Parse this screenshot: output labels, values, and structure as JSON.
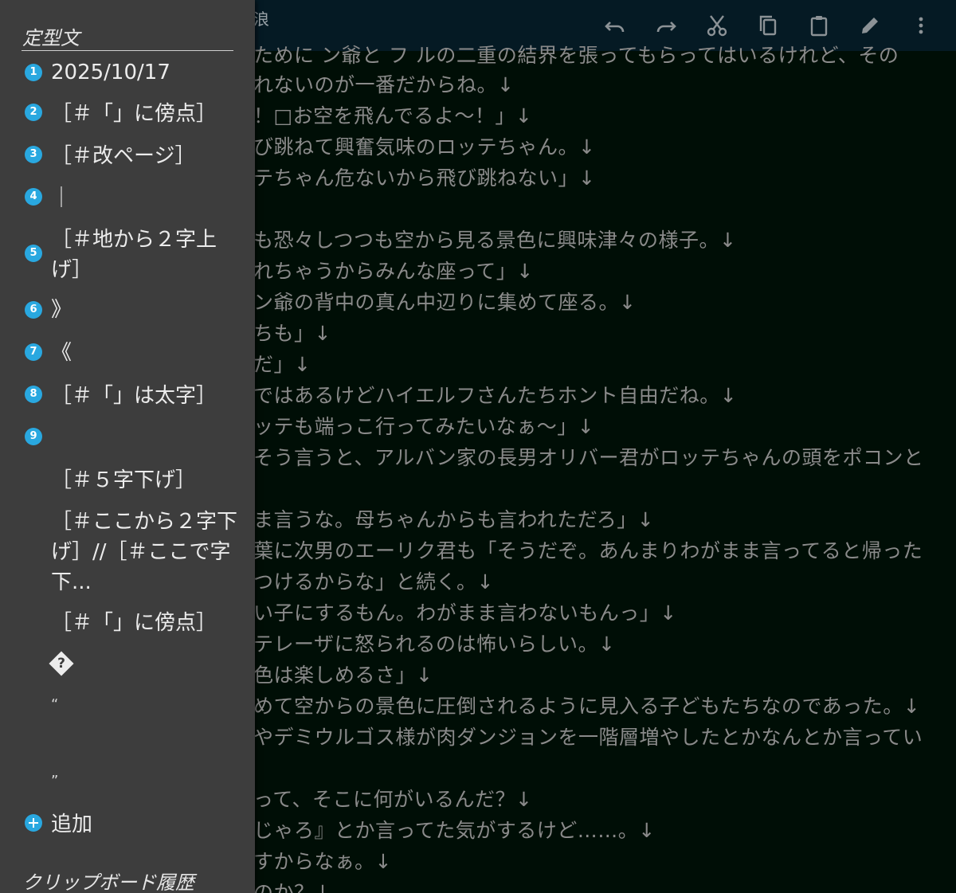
{
  "toolbar": {
    "doc_title": "浪",
    "icons": [
      "undo-icon",
      "redo-icon",
      "cut-icon",
      "copy-icon",
      "paste-icon",
      "edit-icon",
      "more-icon"
    ]
  },
  "editor": {
    "lines": [
      "ために ン爺と フ ルの二重の結界を張ってもらってはいるけれど、その",
      "れないのが一番だからね。↓",
      "！□お空を飛んでるよ～！」↓",
      "び跳ねて興奮気味のロッテちゃん。↓",
      "テちゃん危ないから飛び跳ねない」↓",
      "",
      "も恐々しつつも空から見る景色に興味津々の様子。↓",
      "れちゃうからみんな座って」↓",
      "ン爺の背中の真ん中辺りに集めて座る。↓",
      "ちも」↓",
      "だ」↓",
      "ではあるけどハイエルフさんたちホント自由だね。↓",
      "ッテも端っこ行ってみたいなぁ～」↓",
      "そう言うと、アルバン家の長男オリバー君がロッテちゃんの頭をポコンと",
      "",
      "ま言うな。母ちゃんからも言われただろ」↓",
      "葉に次男のエーリク君も「そうだぞ。あんまりわがまま言ってると帰った",
      "つけるからな」と続く。↓",
      "い子にするもん。わがまま言わないもんっ」↓",
      "テレーザに怒られるのは怖いらしい。↓",
      "色は楽しめるさ」↓",
      "めて空からの景色に圧倒されるように見入る子どもたちなのであった。↓",
      "やデミウルゴス様が肉ダンジョンを一階層増やしたとかなんとか言ってい",
      "",
      "って、そこに何がいるんだ？↓",
      "じゃろ』とか言ってた気がするけど……。↓",
      "すからなぁ。↓",
      "のか？↓"
    ]
  },
  "drawer": {
    "snippets_title": "定型文",
    "items": [
      {
        "number": "1",
        "text": "2025/10/17"
      },
      {
        "number": "2",
        "text": "［＃「」に傍点］"
      },
      {
        "number": "3",
        "text": "［＃改ページ］"
      },
      {
        "number": "4",
        "text": "｜"
      },
      {
        "number": "5",
        "text": "［＃地から２字上げ］"
      },
      {
        "number": "6",
        "text": "》"
      },
      {
        "number": "7",
        "text": "《"
      },
      {
        "number": "8",
        "text": "［＃「」は太字］"
      },
      {
        "number": "9",
        "text": ""
      }
    ],
    "extra_items": [
      "［＃５字下げ］",
      "［＃ここから２字下げ］//［＃ここで字下...",
      "［＃「」に傍点］",
      "?",
      "“",
      "”"
    ],
    "add_label": "追加",
    "clipboard_title": "クリップボード履歴"
  },
  "colors": {
    "drawer_bg": "#3d3d3d",
    "editor_bg": "#000e06",
    "toolbar_bg": "#051a24",
    "accent": "#29a8e0"
  }
}
